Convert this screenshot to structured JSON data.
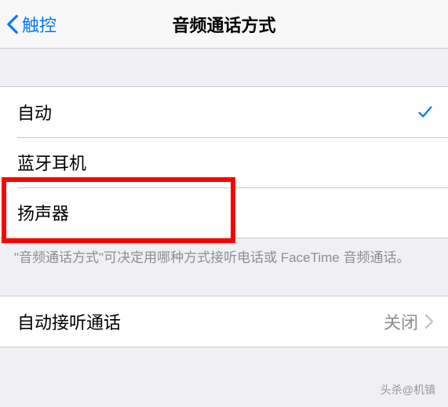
{
  "header": {
    "back_label": "触控",
    "title": "音频通话方式"
  },
  "audio_routing": {
    "options": [
      {
        "label": "自动",
        "selected": true
      },
      {
        "label": "蓝牙耳机",
        "selected": false
      },
      {
        "label": "扬声器",
        "selected": false
      }
    ],
    "description": "\"音频通话方式\"可决定用哪种方式接听电话或 FaceTime 音频通话。"
  },
  "auto_answer": {
    "label": "自动接听通话",
    "value": "关闭"
  },
  "watermark": "头杀@机镇"
}
